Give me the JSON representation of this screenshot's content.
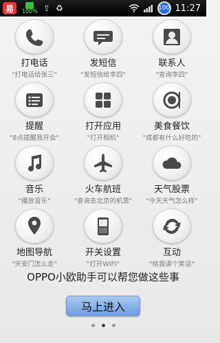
{
  "statusbar": {
    "app_badge": "易",
    "battery_small": "100%",
    "circle_value": "100",
    "time": "11:27"
  },
  "apps": [
    {
      "name": "call",
      "label": "打电话",
      "sub": "\"打电话给张三\"",
      "icon": "phone-icon"
    },
    {
      "name": "sms",
      "label": "发短信",
      "sub": "\"发短信给李四\"",
      "icon": "sms-icon"
    },
    {
      "name": "contacts",
      "label": "联系人",
      "sub": "\"查询李四\"",
      "icon": "contact-icon"
    },
    {
      "name": "reminder",
      "label": "提醒",
      "sub": "\"8点提醒我开会\"",
      "icon": "reminder-icon"
    },
    {
      "name": "open-app",
      "label": "打开应用",
      "sub": "\"打开相机\"",
      "icon": "apps-grid-icon"
    },
    {
      "name": "food",
      "label": "美食餐饮",
      "sub": "\"成都有什么好吃的\"",
      "icon": "food-icon"
    },
    {
      "name": "music",
      "label": "音乐",
      "sub": "\"播放音乐\"",
      "icon": "music-icon"
    },
    {
      "name": "travel",
      "label": "火车航班",
      "sub": "\"查询去北京的机票\"",
      "icon": "plane-icon"
    },
    {
      "name": "weather",
      "label": "天气股票",
      "sub": "\"今天天气怎么样\"",
      "icon": "weather-icon"
    },
    {
      "name": "map",
      "label": "地图导航",
      "sub": "\"天安门怎么走\"",
      "icon": "map-pin-icon"
    },
    {
      "name": "switch",
      "label": "开关设置",
      "sub": "\"打开WIFI\"",
      "icon": "switch-icon"
    },
    {
      "name": "chat",
      "label": "互动",
      "sub": "\"给我讲个笑话\"",
      "icon": "refresh-icon"
    }
  ],
  "footer": {
    "description": "OPPO小欧助手可以帮您做这些事",
    "enter_label": "马上进入"
  }
}
